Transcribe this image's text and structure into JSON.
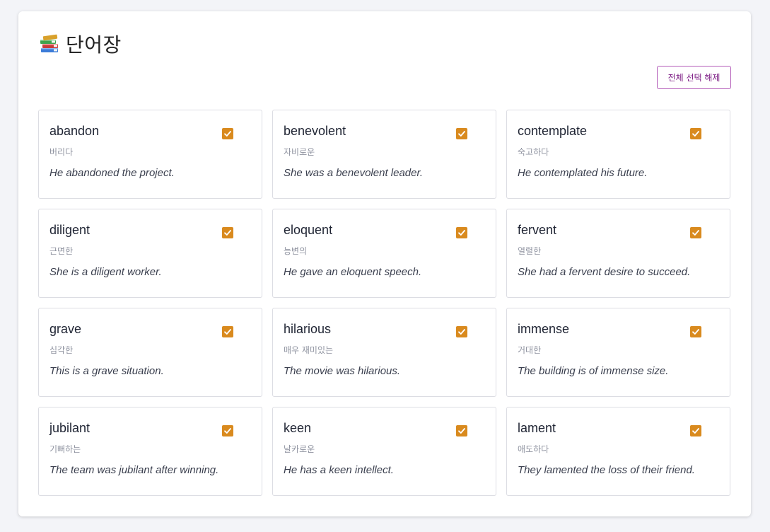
{
  "header": {
    "title": "단어장",
    "title_icon": "books-icon",
    "deselect_all_label": "전체 선택 해제"
  },
  "colors": {
    "accent_checkbox": "#d98a1e",
    "button_border": "#b25ab8",
    "button_text": "#7e1f86"
  },
  "words": [
    {
      "word": "abandon",
      "meaning": "버리다",
      "example": "He abandoned the project.",
      "checked": true
    },
    {
      "word": "benevolent",
      "meaning": "자비로운",
      "example": "She was a benevolent leader.",
      "checked": true
    },
    {
      "word": "contemplate",
      "meaning": "숙고하다",
      "example": "He contemplated his future.",
      "checked": true
    },
    {
      "word": "diligent",
      "meaning": "근면한",
      "example": "She is a diligent worker.",
      "checked": true
    },
    {
      "word": "eloquent",
      "meaning": "능변의",
      "example": "He gave an eloquent speech.",
      "checked": true
    },
    {
      "word": "fervent",
      "meaning": "열렬한",
      "example": "She had a fervent desire to succeed.",
      "checked": true
    },
    {
      "word": "grave",
      "meaning": "심각한",
      "example": "This is a grave situation.",
      "checked": true
    },
    {
      "word": "hilarious",
      "meaning": "매우 재미있는",
      "example": "The movie was hilarious.",
      "checked": true
    },
    {
      "word": "immense",
      "meaning": "거대한",
      "example": "The building is of immense size.",
      "checked": true
    },
    {
      "word": "jubilant",
      "meaning": "기뻐하는",
      "example": "The team was jubilant after winning.",
      "checked": true
    },
    {
      "word": "keen",
      "meaning": "날카로운",
      "example": "He has a keen intellect.",
      "checked": true
    },
    {
      "word": "lament",
      "meaning": "애도하다",
      "example": "They lamented the loss of their friend.",
      "checked": true
    }
  ]
}
